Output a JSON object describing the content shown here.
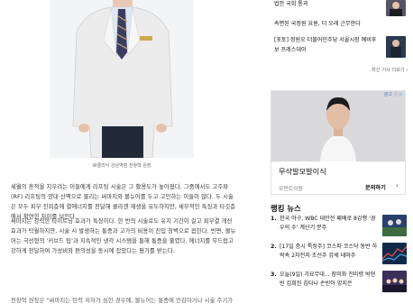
{
  "article": {
    "photo_caption": "W클리닉 강남역점 전창혁 원장",
    "paragraphs": [
      "세월의 흔적을 지우려는 이들에게 리프팅 시술은 그 활용도가 높아졌다. 그중에서도 고주파(RF) 리프팅의 양대 산맥으로 불리는 써마지와 볼뉴어를 두고 고민하는 이들이 많다. 두 시술은 모두 피부 진피층에 열에너지를 전달해 콜라겐 재생을 유도하지만, 세부적인 특징과 타깃층에서 확연한 차이를 보인다.",
      "써마지는 강력한 타이트닝 효과가 특징이다. 한 번의 시술로도 유지 기간이 길고 피부결 개선 효과가 탁월하지만, 시술 시 발생하는 통증과 고가의 비용이 진입 장벽으로 꼽힌다. 반면, 볼뉴어는 극선형의 '커브드 팁'과 지속적인 냉각 시스템을 통해 통증을 줄였다. 에너지를 부드럽고 강하게 전달하여 가성비와 편의성을 동시에 잡았다는 평가를 받는다.",
      "",
      "전창혁 원장은 \"써마지는 탄력 저하가 심한 경우에, 볼뉴어는 통증에 민감하거나 시술 주기가 짧은 경우에 적합하다\"고 설명했다."
    ]
  },
  "sidebar": {
    "news": [
      {
        "text": "법안 국회 통과",
        "thumb": "portrait-dark"
      },
      {
        "text": "속편된 국정원 요원, 더 오래 근무한다",
        "thumb": ""
      },
      {
        "text": "[포토] 정원오 더불어민주당 서울시장 예비후보 프레스데이",
        "thumb": "photo-press"
      }
    ],
    "more_label": "최신 기사 더보기 ›",
    "ad": {
      "label": "광고 ⓘ ▷",
      "title": "무삭발모발이식",
      "source": "모먼트의원",
      "cta": "문의하기",
      "cta_arrow": "›"
    },
    "ranking_title": "랭킹 뉴스",
    "ranking": [
      {
        "num": "1.",
        "text": "한국 야구, WBC 대만전 패배로 8강행 '경우의 수' 계산기 분주"
      },
      {
        "num": "2.",
        "text": "[17일 증시 특징주] 코스피·코스닥 동반 하락속 2차전지·조선주 강세 테마주"
      },
      {
        "num": "3.",
        "text": "오늘(9일) 가요무대... 장미화 진미령 박현빈 김희진 김다나 손빈아 양지은"
      }
    ]
  }
}
